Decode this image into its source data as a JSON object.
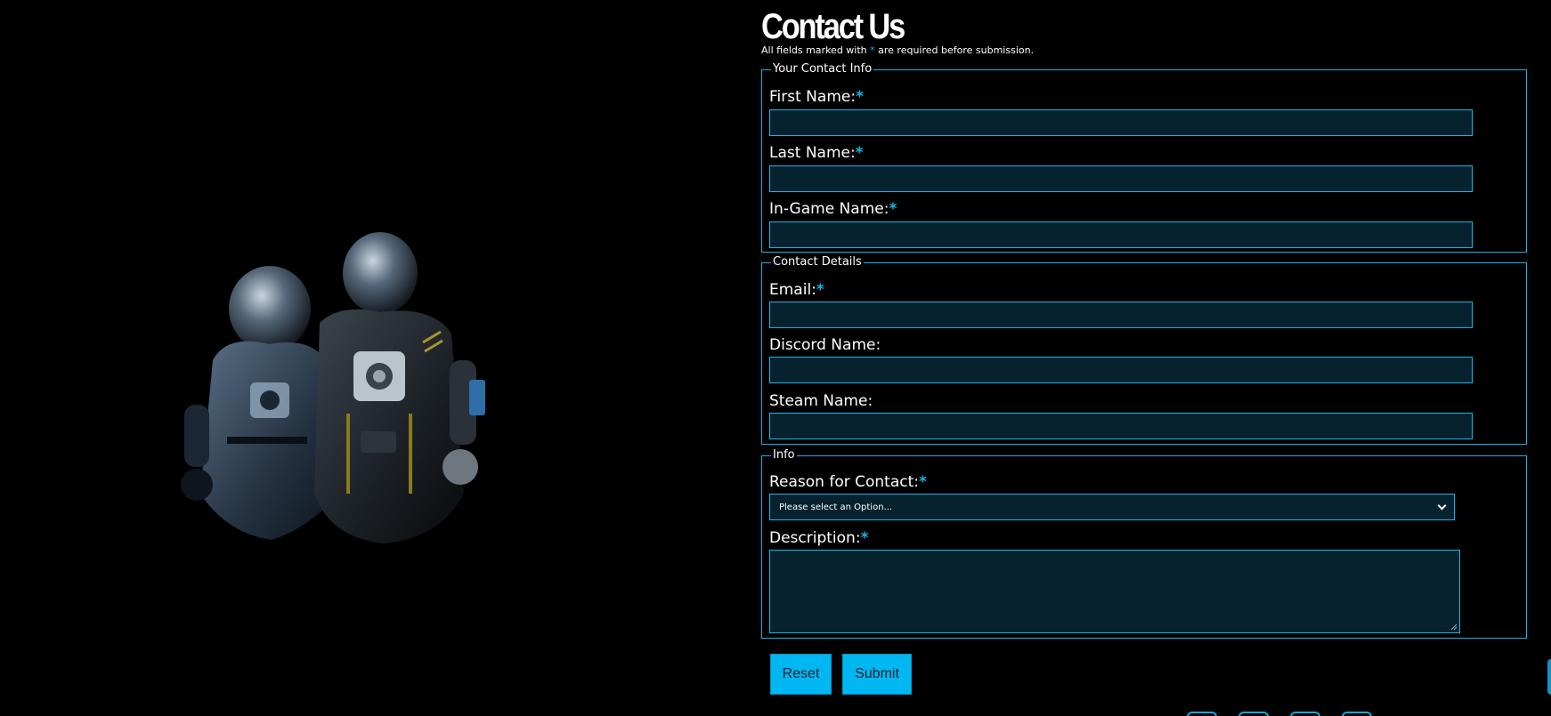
{
  "page": {
    "title": "Contact Us",
    "required_note_before": "All fields marked with ",
    "required_star": "*",
    "required_note_after": " are required before submission."
  },
  "sections": {
    "contact_info": {
      "legend": "Your Contact Info",
      "first_name_label": "First Name:",
      "last_name_label": "Last Name:",
      "in_game_name_label": "In-Game Name:"
    },
    "contact_details": {
      "legend": "Contact Details",
      "email_label": "Email:",
      "discord_label": "Discord Name:",
      "steam_label": "Steam Name:"
    },
    "info": {
      "legend": "Info",
      "reason_label": "Reason for Contact:",
      "reason_selected": "Please select an Option...",
      "description_label": "Description:"
    }
  },
  "buttons": {
    "reset": "Reset",
    "submit": "Submit"
  },
  "colors": {
    "accent": "#10b5e8",
    "field_bg": "#06222e",
    "button_bg": "#00b7f1",
    "page_bg": "#000000"
  },
  "icons": [
    "astronaut-illustration",
    "chevron-down-icon",
    "social-icon"
  ]
}
